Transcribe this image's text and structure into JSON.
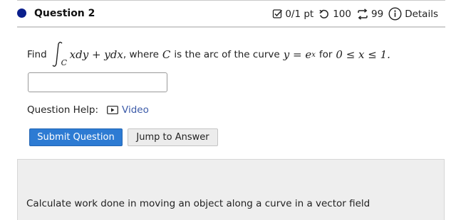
{
  "header": {
    "title": "Question 2",
    "score": "0/1 pt",
    "retries": "100",
    "attempts": "99",
    "details_label": "Details",
    "icons": [
      "checkbox-icon",
      "retry-icon",
      "attempts-icon",
      "info-icon"
    ]
  },
  "question": {
    "prefix": "Find",
    "integral_sub": "C",
    "integrand": "xdy + ydx",
    "mid_text": ", where",
    "curve_symbol": "C",
    "curve_text": "is the arc of the curve",
    "equation_lhs": "y = e",
    "equation_exp": "x",
    "for_text": "for",
    "range": "0 ≤ x ≤ 1."
  },
  "answer": {
    "value": "",
    "placeholder": ""
  },
  "help": {
    "label": "Question Help:",
    "video_label": "Video",
    "icon": "video-play-icon"
  },
  "buttons": {
    "submit_label": "Submit Question",
    "jump_label": "Jump to Answer",
    "submit_color": "#2d7bd3"
  },
  "panel": {
    "text": "Calculate work done in moving an object along a curve in a vector field"
  },
  "colors": {
    "accent": "#2d7bd3",
    "dot": "#0b1f8c",
    "link": "#3b5aa8"
  }
}
